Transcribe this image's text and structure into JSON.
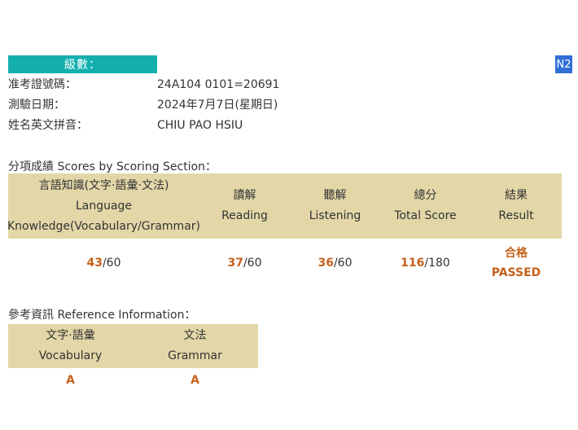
{
  "level": {
    "label": "級數：",
    "badge": "N2"
  },
  "info": [
    {
      "label": "准考證號碼：",
      "value": "24A104 0101=20691"
    },
    {
      "label": "測驗日期：",
      "value": "2024年7月7日(星期日)"
    },
    {
      "label": "姓名英文拼音：",
      "value": "CHIU PAO HSIU"
    }
  ],
  "scores": {
    "title": "分項成績 Scores by Scoring Section：",
    "headers": [
      {
        "zh": "言語知識(文字·語彙·文法)",
        "en1": "Language",
        "en2": "Knowledge(Vocabulary/Grammar)"
      },
      {
        "zh": "讀解",
        "en": "Reading"
      },
      {
        "zh": "聽解",
        "en": "Listening"
      },
      {
        "zh": "總分",
        "en": "Total Score"
      },
      {
        "zh": "結果",
        "en": "Result"
      }
    ],
    "values": [
      {
        "got": "43",
        "total": "/60"
      },
      {
        "got": "37",
        "total": "/60"
      },
      {
        "got": "36",
        "total": "/60"
      },
      {
        "got": "116",
        "total": "/180"
      }
    ],
    "result": {
      "zh": "合格",
      "en": "PASSED"
    }
  },
  "reference": {
    "title": "參考資訊 Reference Information：",
    "headers": [
      {
        "zh": "文字·語彙",
        "en": "Vocabulary"
      },
      {
        "zh": "文法",
        "en": "Grammar"
      }
    ],
    "grades": [
      "A",
      "A"
    ]
  },
  "colors": {
    "level_bar": "#15b0ae",
    "badge": "#2f6fd6",
    "table_head": "#e3d7a8",
    "highlight": "#c5611b"
  }
}
